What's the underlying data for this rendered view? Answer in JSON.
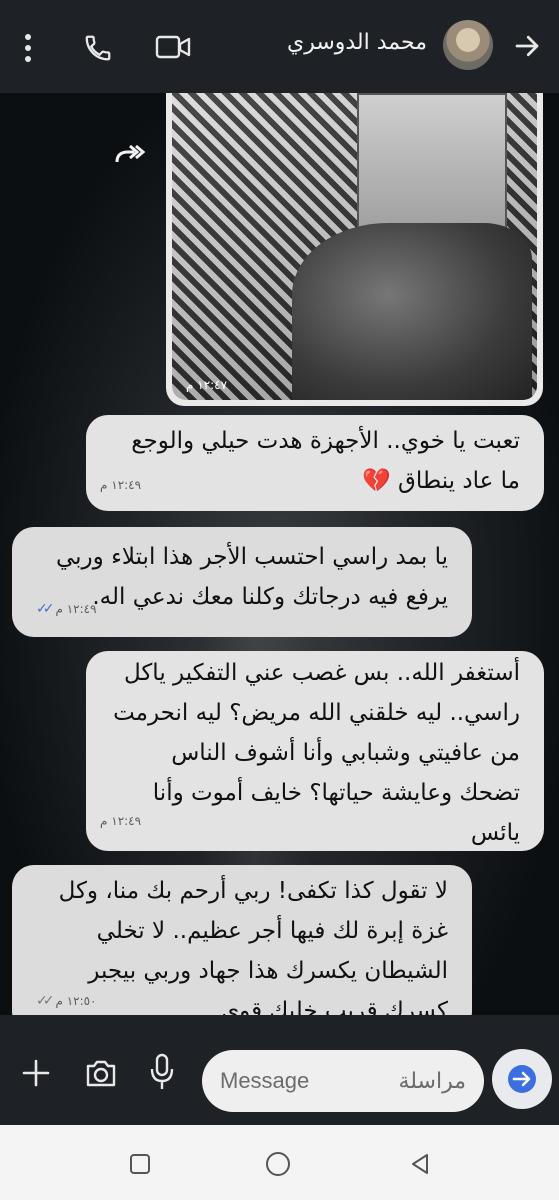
{
  "header": {
    "contact_name": "محمد الدوسري",
    "icons": [
      "more-icon",
      "call-icon",
      "video-icon",
      "avatar",
      "back-arrow-icon"
    ]
  },
  "messages": [
    {
      "type": "image",
      "direction": "in",
      "time": "١٢:٤٧ م"
    },
    {
      "type": "text",
      "direction": "in",
      "lines": [
        "تعبت يا خوي.. الأجهزة هدت حيلي والوجع",
        "ما عاد ينطاق 💔"
      ],
      "time": "١٢:٤٩ م"
    },
    {
      "type": "text",
      "direction": "out",
      "lines": [
        "يا بمد راسي احتسب الأجر هذا ابتلاء وربي",
        "يرفع فيه درجاتك وكلنا معك ندعي اله."
      ],
      "time": "١٢:٤٩ م",
      "read": true
    },
    {
      "type": "text",
      "direction": "in",
      "lines": [
        "أستغفر الله.. بس غصب عني التفكير ياكل",
        "راسي.. ليه خلقني الله مريض؟ ليه انحرمت",
        "من عافيتي وشبابي وأنا أشوف الناس",
        "تضحك وعايشة حياتها؟ خايف أموت وأنا",
        "يائس"
      ],
      "time": "١٢:٤٩ م"
    },
    {
      "type": "text",
      "direction": "out",
      "lines": [
        "لا تقول كذا تكفى! ربي أرحم بك منا، وكل",
        "غزة إبرة لك فيها أجر عظيم.. لا تخلي",
        "الشيطان يكسرك هذا جهاد وربي بيجبر",
        "كسرك قريب خليك قوي."
      ],
      "time": "١٢:٥٠ م",
      "read": true
    }
  ],
  "composer": {
    "placeholder_en": "Message",
    "placeholder_ar": "مراسلة"
  },
  "colors": {
    "topbar": "#1e2226",
    "bubble": "#e3e3e3",
    "read_ticks": "#4a6fc7",
    "send_arrow": "#3b6fe0"
  }
}
